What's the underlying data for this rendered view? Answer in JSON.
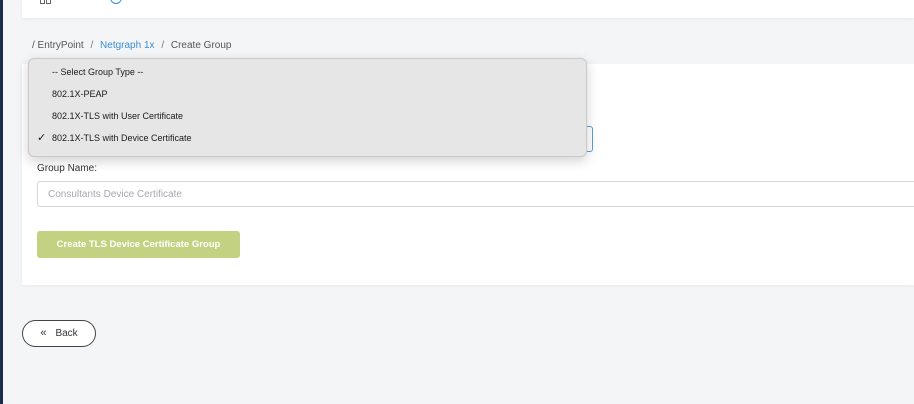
{
  "breadcrumb": {
    "root": "/ EntryPoint",
    "sep": "/",
    "link": "Netgraph 1x",
    "current": "Create Group"
  },
  "dropdown": {
    "options": [
      "-- Select Group Type --",
      "802.1X-PEAP",
      "802.1X-TLS with User Certificate",
      "802.1X-TLS with Device Certificate"
    ],
    "selected_index": 3,
    "check_mark": "✓"
  },
  "form": {
    "group_name_label": "Group Name:",
    "group_name_placeholder": "Consultants Device Certificate",
    "create_button_label": "Create TLS Device Certificate Group"
  },
  "back": {
    "icon": "«",
    "label": "Back"
  },
  "colors": {
    "accent_link": "#3a8fd6",
    "create_button": "#c3d182"
  }
}
